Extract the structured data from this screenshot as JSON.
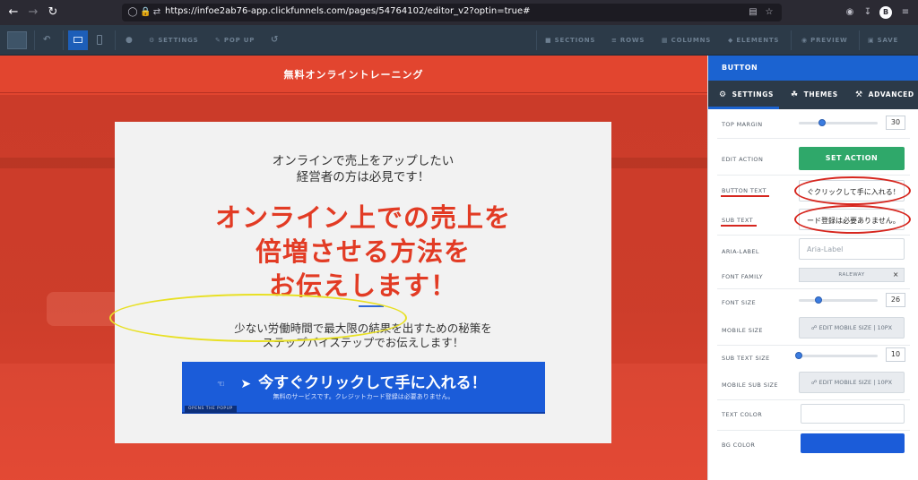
{
  "browser": {
    "url": "https://infoe2ab76-app.clickfunnels.com/pages/54764102/editor_v2?optin=true#",
    "avatar_letter": "B"
  },
  "toolbar": {
    "settings": "SETTINGS",
    "popup": "POP UP",
    "sections": "SECTIONS",
    "rows": "ROWS",
    "columns": "COLUMNS",
    "elements": "ELEMENTS",
    "preview": "PREVIEW",
    "save": "SAVE"
  },
  "page": {
    "header_title": "無料オンライントレーニング",
    "pre_headline_1": "オンラインで売上をアップしたい",
    "pre_headline_2": "経営者の方は必見です！",
    "headline_1": "オンライン上での売上を",
    "headline_2": "倍増させる方法を",
    "headline_3": "お伝えします！",
    "desc_1": "少ない労働時間で最大限の結果を出すための秘策を",
    "desc_2": "ステップバイステップでお伝えします！",
    "cta_text": "今すぐクリックして手に入れる！",
    "cta_subtext": "無料のサービスです。クレジットカード登録は必要ありません。",
    "cta_tag": "OPENS THE POPUP"
  },
  "panel": {
    "title": "BUTTON",
    "tabs": [
      "SETTINGS",
      "THEMES",
      "ADVANCED"
    ],
    "top_margin_label": "TOP MARGIN",
    "top_margin_value": "30",
    "edit_action_label": "EDIT ACTION",
    "set_action_label": "SET ACTION",
    "button_text_label": "BUTTON TEXT",
    "button_text_value": "ぐクリックして手に入れる！",
    "sub_text_label": "SUB TEXT",
    "sub_text_value": "ード登録は必要ありません。",
    "aria_label_label": "ARIA-LABEL",
    "aria_label_placeholder": "Aria-Label",
    "font_family_label": "FONT FAMILY",
    "font_family_value": "RALEWAY",
    "font_size_label": "FONT SIZE",
    "font_size_value": "26",
    "mobile_size_label": "MOBILE SIZE",
    "edit_mobile_size": "EDIT MOBILE SIZE",
    "mobile_size_value": "10PX",
    "sub_text_size_label": "SUB TEXT SIZE",
    "sub_text_size_value": "10",
    "mobile_sub_size_label": "MOBILE SUB SIZE",
    "mobile_sub_size_value": "10PX",
    "text_color_label": "TEXT COLOR",
    "bg_color_label": "BG COLOR",
    "text_color": "#ffffff",
    "bg_color": "#1b5cd9"
  },
  "colors": {
    "accent": "#1b63d1",
    "headline_red": "#e23b24",
    "cta_blue": "#1b5cd9",
    "set_action_green": "#2fa86a",
    "annotation_red": "#d6261e",
    "annotation_yellow": "#e8e024"
  }
}
